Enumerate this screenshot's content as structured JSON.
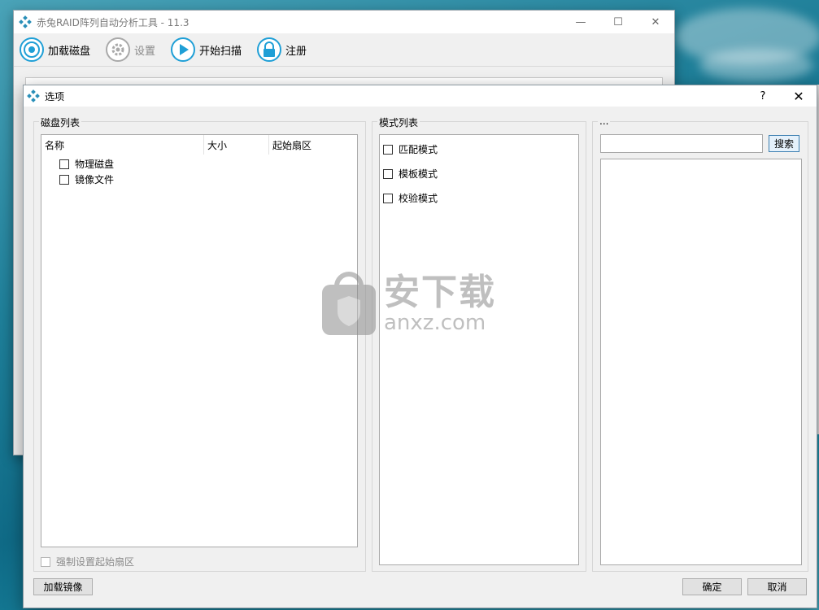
{
  "main_window": {
    "title": "赤兔RAID阵列自动分析工具 - 11.3",
    "controls": {
      "minimize": "—",
      "maximize": "☐",
      "close": "✕"
    },
    "toolbar": [
      {
        "id": "load-disk",
        "label": "加载磁盘",
        "icon": "disk-icon",
        "enabled": true
      },
      {
        "id": "settings",
        "label": "设置",
        "icon": "gear-icon",
        "enabled": false
      },
      {
        "id": "start-scan",
        "label": "开始扫描",
        "icon": "play-icon",
        "enabled": true
      },
      {
        "id": "register",
        "label": "注册",
        "icon": "lock-icon",
        "enabled": true
      }
    ]
  },
  "dialog": {
    "title": "选项",
    "help": "?",
    "close": "✕",
    "disk_group": {
      "legend": "磁盘列表",
      "columns": [
        "名称",
        "大小",
        "起始扇区"
      ],
      "items": [
        "物理磁盘",
        "镜像文件"
      ],
      "force_checkbox": "强制设置起始扇区"
    },
    "mode_group": {
      "legend": "模式列表",
      "modes": [
        "匹配模式",
        "模板模式",
        "校验模式"
      ]
    },
    "search_group": {
      "legend": "...",
      "search_value": "",
      "search_button": "搜索"
    },
    "buttons": {
      "load_image": "加载镜像",
      "ok": "确定",
      "cancel": "取消"
    }
  },
  "watermark": {
    "cn": "安下载",
    "en": "anxz.com"
  },
  "colors": {
    "accent": "#1f9fd6",
    "disabled": "#8a8a8a",
    "dialog_bg": "#f0f0f0"
  }
}
